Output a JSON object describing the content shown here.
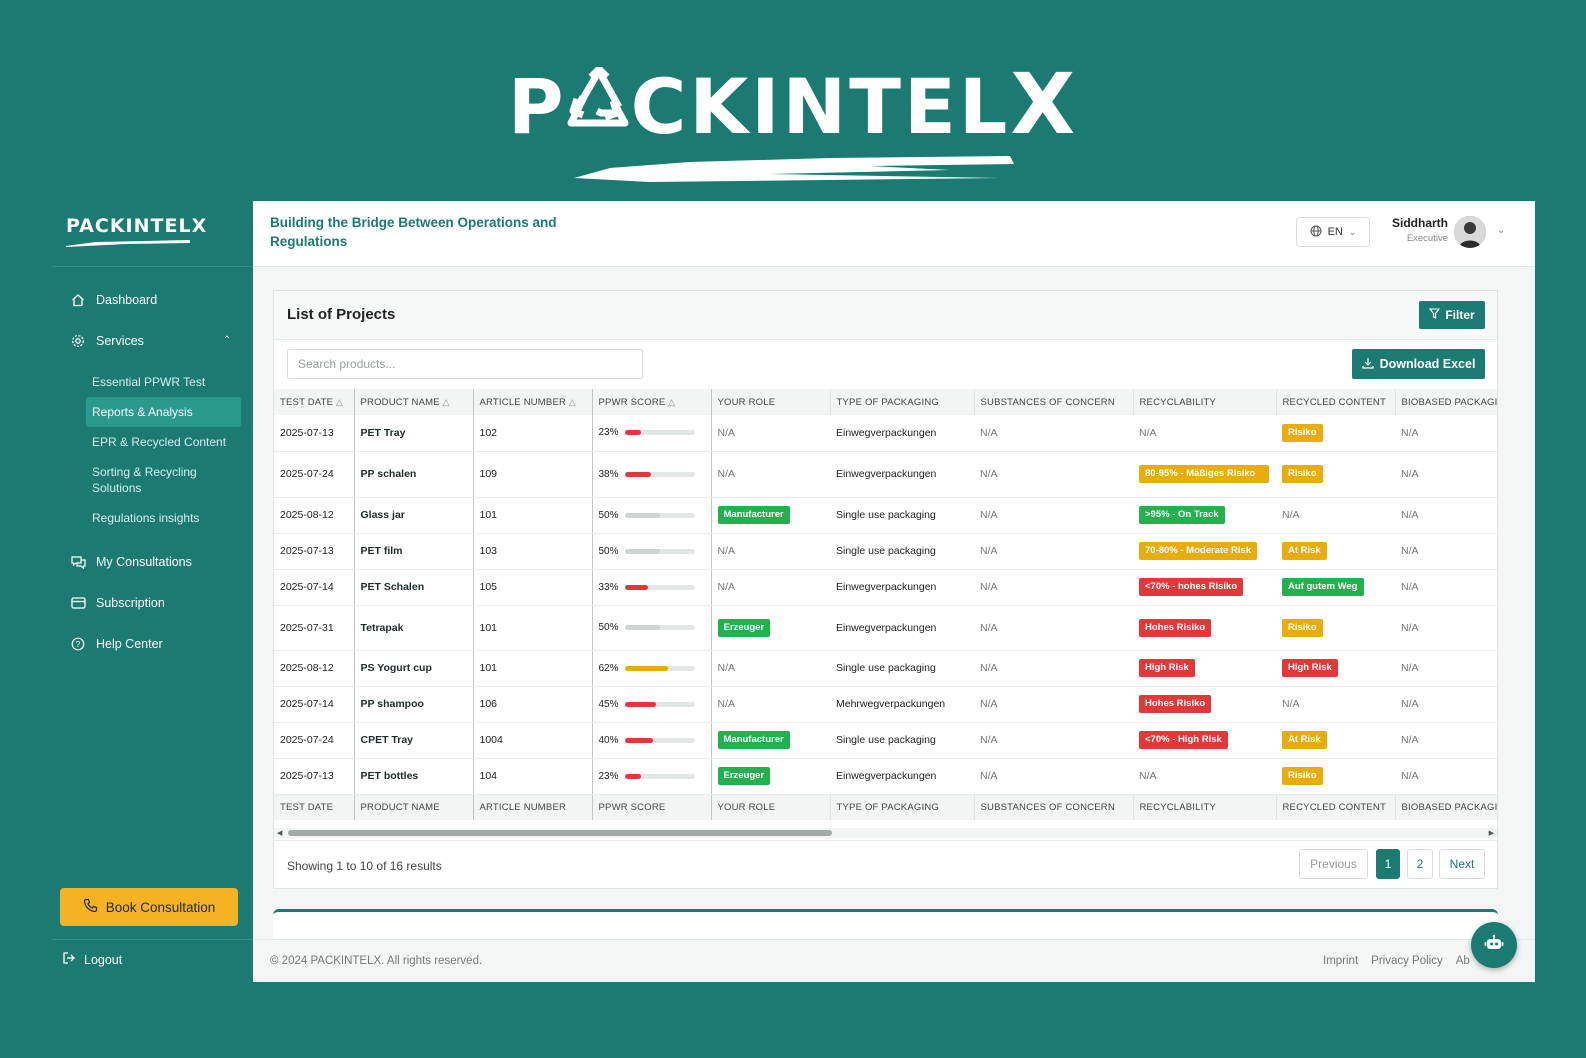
{
  "brand": {
    "name": "PACKINTELX",
    "prefix": "P",
    "suffix_main": "CKINTEL",
    "suffix_x": "X"
  },
  "sidebar": {
    "logo": "PACKINTELX",
    "nav": [
      {
        "label": "Dashboard",
        "icon": "home-icon"
      },
      {
        "label": "Services",
        "icon": "gear-icon"
      }
    ],
    "services_sub": [
      "Essential PPWR Test",
      "Reports & Analysis",
      "EPR & Recycled Content",
      "Sorting & Recycling Solutions",
      "Regulations insights"
    ],
    "nav_bottom": [
      {
        "label": "My Consultations",
        "icon": "chat-icon"
      },
      {
        "label": "Subscription",
        "icon": "card-icon"
      },
      {
        "label": "Help Center",
        "icon": "help-icon"
      }
    ],
    "active_sub": "Reports & Analysis",
    "book_label": "Book Consultation",
    "logout_label": "Logout"
  },
  "header": {
    "tagline": "Building the Bridge Between Operations and Regulations",
    "language": "EN",
    "user_name": "Siddharth",
    "user_role": "Executive"
  },
  "projects": {
    "title": "List of Projects",
    "filter_label": "Filter",
    "search_placeholder": "Search products...",
    "download_label": "Download Excel",
    "columns": [
      "TEST DATE",
      "PRODUCT NAME",
      "ARTICLE NUMBER",
      "PPWR SCORE",
      "YOUR ROLE",
      "TYPE OF PACKAGING",
      "SUBSTANCES OF CONCERN",
      "RECYCLABILITY",
      "RECYCLED CONTENT",
      "BIOBASED PACKAGING"
    ],
    "rows": [
      {
        "date": "2025-07-13",
        "name": "PET Tray",
        "article": "102",
        "score": "23%",
        "score_value": 23,
        "score_color": "#e2383a",
        "role": "N/A",
        "role_badge": "",
        "packaging": "Einwegverpackungen",
        "substances": "N/A",
        "recyclability": "N/A",
        "recyc_color": "",
        "recycled": "Risiko",
        "recycled_color": "yellow",
        "biobased": "N/A",
        "tall": false
      },
      {
        "date": "2025-07-24",
        "name": "PP schalen",
        "article": "109",
        "score": "38%",
        "score_value": 38,
        "score_color": "#e2383a",
        "role": "N/A",
        "role_badge": "",
        "packaging": "Einwegverpackungen",
        "substances": "N/A",
        "recyclability": "80-95% - Mäßiges Risiko",
        "recyc_color": "yellow",
        "recycled": "Risiko",
        "recycled_color": "yellow",
        "biobased": "N/A",
        "tall": true
      },
      {
        "date": "2025-08-12",
        "name": "Glass jar",
        "article": "101",
        "score": "50%",
        "score_value": 50,
        "score_color": "#cfd3d3",
        "role": "Manufacturer",
        "role_badge": "green",
        "packaging": "Single use packaging",
        "substances": "N/A",
        "recyclability": ">95% - On Track",
        "recyc_color": "green",
        "recycled": "N/A",
        "recycled_color": "",
        "biobased": "N/A",
        "tall": false
      },
      {
        "date": "2025-07-13",
        "name": "PET film",
        "article": "103",
        "score": "50%",
        "score_value": 50,
        "score_color": "#cfd3d3",
        "role": "N/A",
        "role_badge": "",
        "packaging": "Single use packaging",
        "substances": "N/A",
        "recyclability": "70-80% - Moderate Risk",
        "recyc_color": "yellow",
        "recycled": "At Risk",
        "recycled_color": "yellow",
        "biobased": "N/A",
        "tall": false
      },
      {
        "date": "2025-07-14",
        "name": "PET Schalen",
        "article": "105",
        "score": "33%",
        "score_value": 33,
        "score_color": "#e2383a",
        "role": "N/A",
        "role_badge": "",
        "packaging": "Einwegverpackungen",
        "substances": "N/A",
        "recyclability": "<70% - hohes Risiko",
        "recyc_color": "red",
        "recycled": "Auf gutem Weg",
        "recycled_color": "green",
        "biobased": "N/A",
        "tall": false
      },
      {
        "date": "2025-07-31",
        "name": "Tetrapak",
        "article": "101",
        "score": "50%",
        "score_value": 50,
        "score_color": "#cfd3d3",
        "role": "Erzeuger",
        "role_badge": "green",
        "packaging": "Einwegverpackungen",
        "substances": "N/A",
        "recyclability": "Hohes Risiko",
        "recyc_color": "red",
        "recycled": "Risiko",
        "recycled_color": "yellow",
        "biobased": "N/A",
        "tall": "mid"
      },
      {
        "date": "2025-08-12",
        "name": "PS Yogurt cup",
        "article": "101",
        "score": "62%",
        "score_value": 62,
        "score_color": "#e8ac0c",
        "role": "N/A",
        "role_badge": "",
        "packaging": "Single use packaging",
        "substances": "N/A",
        "recyclability": "High Risk",
        "recyc_color": "red",
        "recycled": "High Risk",
        "recycled_color": "red",
        "biobased": "N/A",
        "tall": false
      },
      {
        "date": "2025-07-14",
        "name": "PP shampoo",
        "article": "106",
        "score": "45%",
        "score_value": 45,
        "score_color": "#e2383a",
        "role": "N/A",
        "role_badge": "",
        "packaging": "Mehrwegverpackungen",
        "substances": "N/A",
        "recyclability": "Hohes Risiko",
        "recyc_color": "red",
        "recycled": "N/A",
        "recycled_color": "",
        "biobased": "N/A",
        "tall": false
      },
      {
        "date": "2025-07-24",
        "name": "CPET Tray",
        "article": "1004",
        "score": "40%",
        "score_value": 40,
        "score_color": "#e2383a",
        "role": "Manufacturer",
        "role_badge": "green",
        "packaging": "Single use packaging",
        "substances": "N/A",
        "recyclability": "<70% - High Risk",
        "recyc_color": "red",
        "recycled": "At Risk",
        "recycled_color": "yellow",
        "biobased": "N/A",
        "tall": false
      },
      {
        "date": "2025-07-13",
        "name": "PET bottles",
        "article": "104",
        "score": "23%",
        "score_value": 23,
        "score_color": "#e2383a",
        "role": "Erzeuger",
        "role_badge": "green",
        "packaging": "Einwegverpackungen",
        "substances": "N/A",
        "recyclability": "N/A",
        "recyc_color": "",
        "recycled": "Risiko",
        "recycled_color": "yellow",
        "biobased": "N/A",
        "tall": false
      }
    ],
    "showing": "Showing 1 to 10 of 16 results",
    "pagination": {
      "prev": "Previous",
      "p1": "1",
      "p2": "2",
      "next": "Next"
    }
  },
  "footer": {
    "copyright": "© 2024 PACKINTELX. All rights reserved.",
    "links": [
      "Imprint",
      "Privacy Policy",
      "Ab"
    ]
  },
  "colors": {
    "primary": "#1b7b72",
    "accent": "#f5b324",
    "green": "#22b14c",
    "yellow": "#e8ac0c",
    "red": "#e2383a"
  }
}
